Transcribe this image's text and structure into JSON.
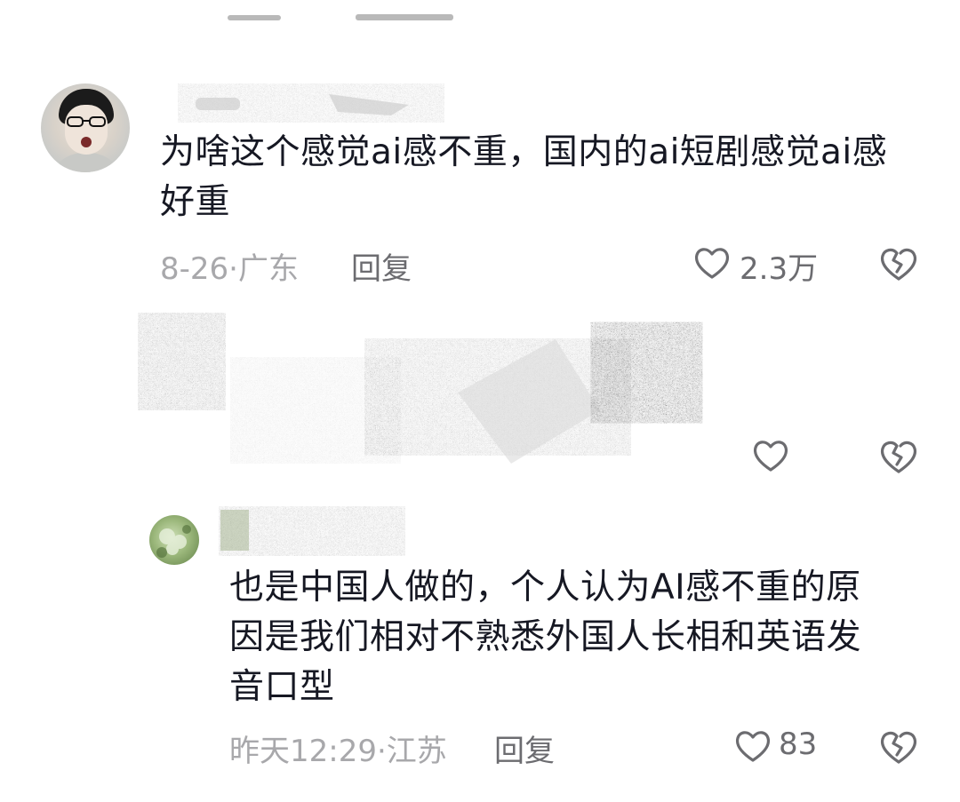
{
  "comments": [
    {
      "text_line1": "为啥这个感觉ai感不重，国内的ai短剧感觉ai感",
      "text_line2": "好重",
      "date_location": "8-26·广东",
      "reply_label": "回复",
      "likes": "2.3万"
    },
    {
      "text_line1": "也是中国人做的，个人认为AI感不重的原",
      "text_line2": "因是我们相对不熟悉外国人长相和英语发",
      "text_line3": "音口型",
      "date_location": "昨天12:29·江苏",
      "reply_label": "回复",
      "likes": "83"
    }
  ],
  "icons": {
    "like": "heart-outline-icon",
    "dislike": "broken-heart-icon"
  },
  "colors": {
    "text": "#161823",
    "meta": "#a8a8ab",
    "action": "#6c6c70"
  }
}
